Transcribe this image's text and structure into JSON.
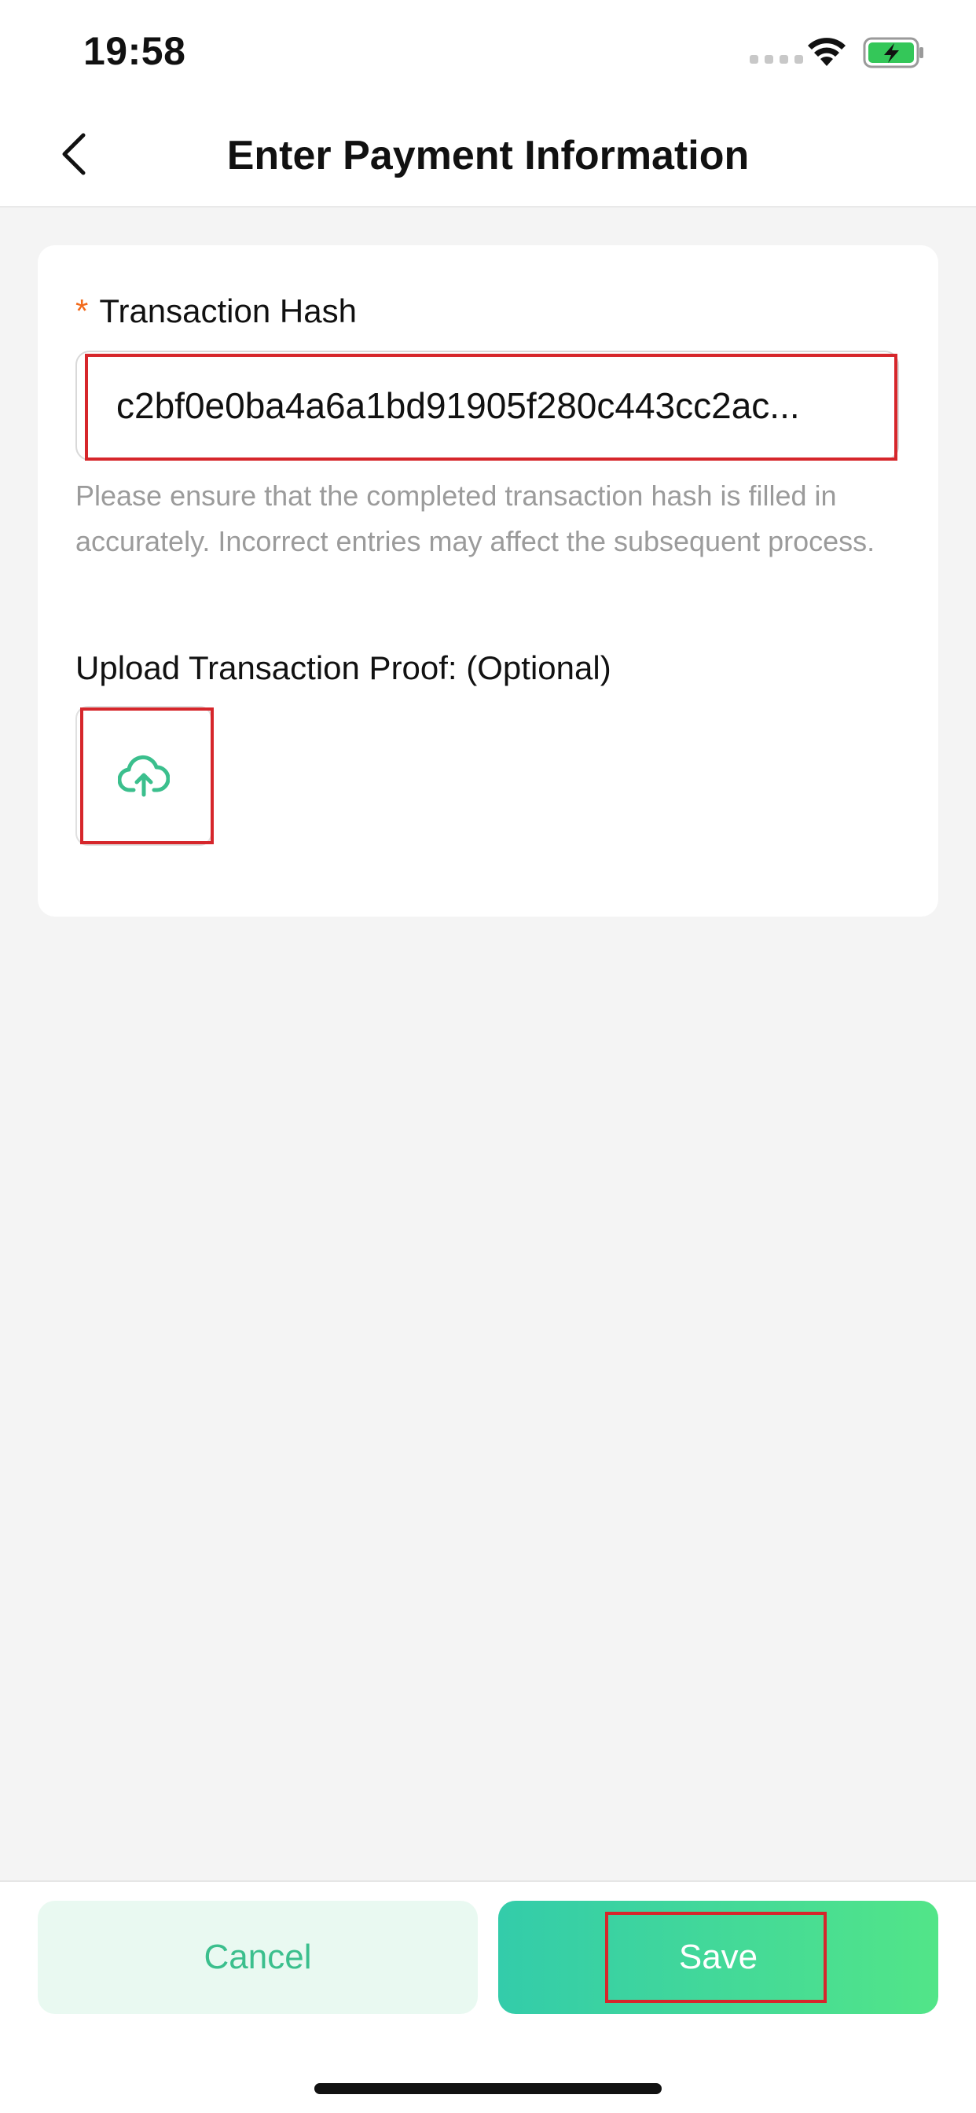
{
  "status_bar": {
    "time": "19:58",
    "wifi_icon": "wifi-icon",
    "battery_icon": "battery-charging-icon",
    "battery_color": "#34c759"
  },
  "nav": {
    "title": "Enter Payment Information",
    "back_icon": "chevron-left-icon"
  },
  "form": {
    "hash_field": {
      "required_mark": "*",
      "label": "Transaction Hash",
      "value": "c2bf0e0ba4a6a1bd91905f280c443cc2ac..."
    },
    "hint": "Please ensure that the completed transaction hash is filled in accurately. Incorrect entries may affect the subsequent process.",
    "upload": {
      "label": "Upload Transaction Proof: (Optional)",
      "icon": "cloud-upload-icon"
    }
  },
  "actions": {
    "cancel_label": "Cancel",
    "save_label": "Save"
  },
  "colors": {
    "accent": "#3bbf8d",
    "required": "#f26a1b",
    "save_gradient_start": "#33ccaa",
    "save_gradient_end": "#52e588",
    "annotation": "#d6262b"
  }
}
